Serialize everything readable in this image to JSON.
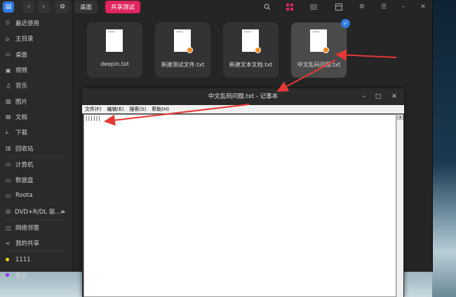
{
  "sidebar": {
    "logo_glyph": "▤",
    "items": [
      {
        "icon": "clock-icon",
        "glyph": "⏲",
        "label": "最近使用"
      },
      {
        "icon": "home-icon",
        "glyph": "⌂",
        "label": "主目录"
      },
      {
        "icon": "desktop-icon",
        "glyph": "▭",
        "label": "桌面"
      },
      {
        "icon": "video-icon",
        "glyph": "▣",
        "label": "视频"
      },
      {
        "icon": "music-icon",
        "glyph": "♫",
        "label": "音乐"
      },
      {
        "icon": "picture-icon",
        "glyph": "▨",
        "label": "图片"
      },
      {
        "icon": "document-icon",
        "glyph": "▤",
        "label": "文档"
      },
      {
        "icon": "download-icon",
        "glyph": "⤓",
        "label": "下载"
      },
      {
        "icon": "trash-icon",
        "glyph": "▥",
        "label": "回收站"
      }
    ],
    "devices": [
      {
        "icon": "computer-icon",
        "glyph": "▭",
        "label": "计算机"
      },
      {
        "icon": "disk-icon",
        "glyph": "▭",
        "label": "数据盘"
      },
      {
        "icon": "disk-icon",
        "glyph": "▭",
        "label": "Roota"
      },
      {
        "icon": "optical-drive-icon",
        "glyph": "◎",
        "label": "DVD+R/DL 驱..."
      }
    ],
    "network": [
      {
        "icon": "network-icon",
        "glyph": "◫",
        "label": "网络邻居"
      },
      {
        "icon": "share-icon",
        "glyph": "<",
        "label": "我的共享"
      }
    ],
    "tags": [
      {
        "label": "1111",
        "color": "#f5d90a"
      },
      {
        "label": "紫色",
        "color": "#9b30ff"
      }
    ]
  },
  "toolbar": {
    "back_glyph": "‹",
    "forward_glyph": "›",
    "home_glyph": "✿",
    "crumbs": [
      "桌面",
      "共享测试"
    ],
    "active_color": "#e0245e"
  },
  "files": [
    {
      "name": "deepin.txt",
      "badge": false,
      "selected": false
    },
    {
      "name": "新建测试文件.txt",
      "badge": true,
      "selected": false
    },
    {
      "name": "新建文本文档.txt",
      "badge": true,
      "selected": false
    },
    {
      "name": "中文乱码问题.txt",
      "badge": true,
      "selected": true
    }
  ],
  "notepad": {
    "title": "中文乱码问题.txt - 记事本",
    "menu": [
      "文件(F)",
      "编辑(E)",
      "搜索(S)",
      "帮助(H)"
    ],
    "content": "||||||"
  },
  "colors": {
    "accent": "#2f7be0",
    "arrow": "#e53935"
  }
}
